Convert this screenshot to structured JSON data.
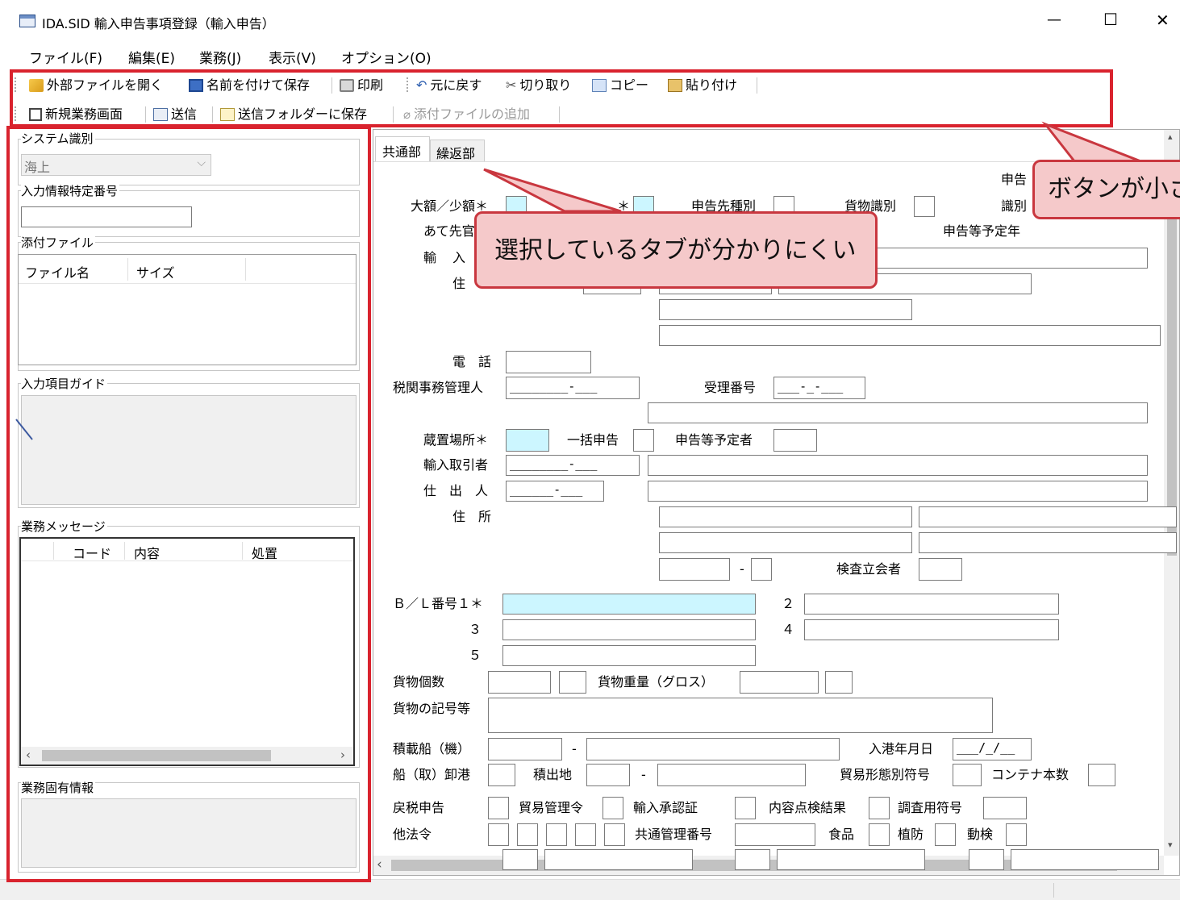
{
  "window": {
    "title": "IDA.SID 輸入申告事項登録（輸入申告）",
    "minimize": "—",
    "maximize": "☐",
    "close": "✕"
  },
  "menu": [
    "ファイル(F)",
    "編集(E)",
    "業務(J)",
    "表示(V)",
    "オプション(O)"
  ],
  "toolbar1": [
    "外部ファイルを開く",
    "名前を付けて保存",
    "印刷",
    "元に戻す",
    "切り取り",
    "コピー",
    "貼り付け"
  ],
  "toolbar2": [
    "新規業務画面",
    "送信",
    "送信フォルダーに保存",
    "添付ファイルの追加"
  ],
  "left": {
    "system_id_label": "システム識別",
    "system_id_value": "海上",
    "input_info_label": "入力情報特定番号",
    "attach_label": "添付ファイル",
    "attach_cols": [
      "ファイル名",
      "サイズ"
    ],
    "guide_label": "入力項目ガイド",
    "msg_label": "業務メッセージ",
    "msg_cols": [
      "コード",
      "内容",
      "処置"
    ],
    "specific_label": "業務固有情報"
  },
  "tabs": [
    "共通部",
    "繰返部"
  ],
  "form": {
    "shinkoku_partial": "申告",
    "shiki_partial": "識別",
    "shinkoku_date_partial": "申告等予定年",
    "daigaku": "大額／少額＊",
    "hidden_star": "＊",
    "shinkoku_saki": "申告先種別",
    "kamotsu_shikibetsu": "貨物識別",
    "atesaki": "あて先官",
    "yu": "輸",
    "nyu": "入",
    "ju": "住",
    "denwa": "電　話",
    "zeikan": "税関事務管理人",
    "zeikan_mask": "________-___",
    "juri": "受理番号",
    "juri_mask": "___-_-___",
    "zochi": "蔵置場所＊",
    "ikkatsu": "一括申告",
    "yoteisha": "申告等予定者",
    "torihiki": "輸入取引者",
    "torihiki_mask": "________-___",
    "shidashi": "仕　出　人",
    "shidashi_mask": "______-___",
    "jusho": "住　所",
    "dash": "-",
    "kensa": "検査立会者",
    "bl1": "Ｂ／Ｌ番号１＊",
    "n2": "２",
    "n3": "３",
    "n4": "４",
    "n5": "５",
    "kosu": "貨物個数",
    "juryo": "貨物重量（グロス）",
    "kigou": "貨物の記号等",
    "sekisai": "積載船（機）",
    "nyuko": "入港年月日",
    "nyuko_mask": "___/_/__",
    "orosi": "船（取）卸港",
    "tsumidashi": "積出地",
    "boueki": "貿易形態別符号",
    "container": "コンテナ本数",
    "modoshi": "戻税申告",
    "kanrirei": "貿易管理令",
    "shoninsho": "輸入承認証",
    "naiyo": "内容点検結果",
    "chosa": "調査用符号",
    "tahorei": "他法令",
    "kyotsu": "共通管理番号",
    "shokuhin": "食品",
    "shokubo": "植防",
    "douken": "動検"
  },
  "callouts": {
    "tab": "選択しているタブが分かりにくい",
    "button": "ボタンが小さ"
  },
  "colors": {
    "highlight": "#d9232e",
    "required_field": "#ccf6ff",
    "callout_fill": "#f5c9ca"
  }
}
